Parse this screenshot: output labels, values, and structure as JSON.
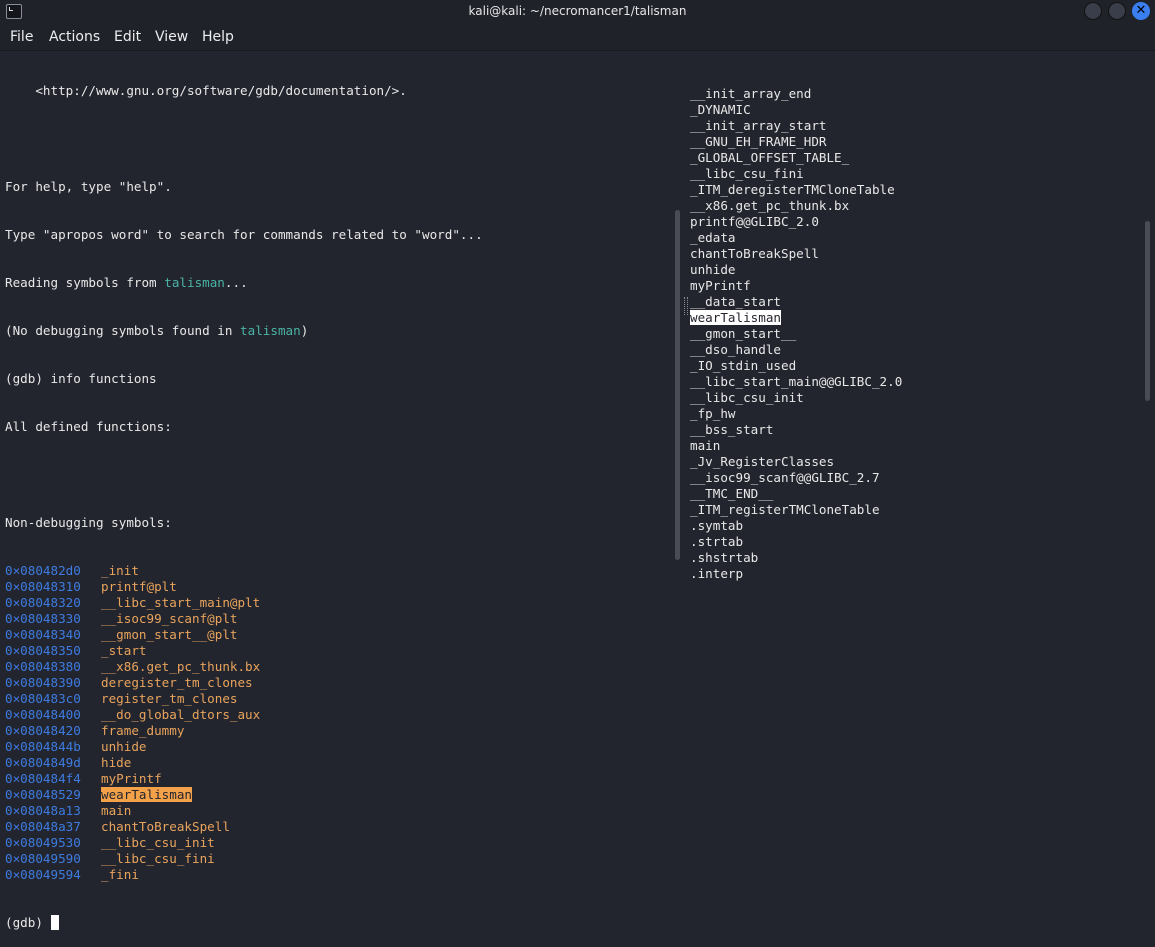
{
  "window": {
    "title": "kali@kali: ~/necromancer1/talisman",
    "icon": "terminal-icon",
    "controls": [
      "minimize",
      "maximize",
      "close"
    ]
  },
  "menu": [
    "File",
    "Actions",
    "Edit",
    "View",
    "Help"
  ],
  "left_pane": {
    "intro_lines": [
      "    <http://www.gnu.org/software/gdb/documentation/>.",
      "",
      "For help, type \"help\".",
      "Type \"apropos word\" to search for commands related to \"word\"..."
    ],
    "reading_prefix": "Reading symbols from ",
    "reading_file": "talisman",
    "reading_suffix": "...",
    "nodebug_prefix": "(No debugging symbols found in ",
    "nodebug_file": "talisman",
    "nodebug_suffix": ")",
    "command": "(gdb) info functions",
    "all_defined": "All defined functions:",
    "blank": "",
    "non_debug_header": "Non-debugging symbols:",
    "symbols": [
      {
        "addr": "0×080482d0",
        "name": "_init"
      },
      {
        "addr": "0×08048310",
        "name": "printf@plt"
      },
      {
        "addr": "0×08048320",
        "name": "__libc_start_main@plt"
      },
      {
        "addr": "0×08048330",
        "name": "__isoc99_scanf@plt"
      },
      {
        "addr": "0×08048340",
        "name": "__gmon_start__@plt"
      },
      {
        "addr": "0×08048350",
        "name": "_start"
      },
      {
        "addr": "0×08048380",
        "name": "__x86.get_pc_thunk.bx"
      },
      {
        "addr": "0×08048390",
        "name": "deregister_tm_clones"
      },
      {
        "addr": "0×080483c0",
        "name": "register_tm_clones"
      },
      {
        "addr": "0×08048400",
        "name": "__do_global_dtors_aux"
      },
      {
        "addr": "0×08048420",
        "name": "frame_dummy"
      },
      {
        "addr": "0×0804844b",
        "name": "unhide"
      },
      {
        "addr": "0×0804849d",
        "name": "hide"
      },
      {
        "addr": "0×080484f4",
        "name": "myPrintf"
      },
      {
        "addr": "0×08048529",
        "name": "wearTalisman",
        "highlight": true
      },
      {
        "addr": "0×08048a13",
        "name": "main"
      },
      {
        "addr": "0×08048a37",
        "name": "chantToBreakSpell"
      },
      {
        "addr": "0×08049530",
        "name": "__libc_csu_init"
      },
      {
        "addr": "0×08049590",
        "name": "__libc_csu_fini"
      },
      {
        "addr": "0×08049594",
        "name": "_fini"
      }
    ],
    "prompt": "(gdb) "
  },
  "right_pane": {
    "lines": [
      "__init_array_end",
      "_DYNAMIC",
      "__init_array_start",
      "__GNU_EH_FRAME_HDR",
      "_GLOBAL_OFFSET_TABLE_",
      "__libc_csu_fini",
      "_ITM_deregisterTMCloneTable",
      "__x86.get_pc_thunk.bx",
      "printf@@GLIBC_2.0",
      "_edata",
      "chantToBreakSpell",
      "unhide",
      "myPrintf",
      "__data_start",
      "wearTalisman",
      "__gmon_start__",
      "__dso_handle",
      "_IO_stdin_used",
      "__libc_start_main@@GLIBC_2.0",
      "__libc_csu_init",
      "_fp_hw",
      "__bss_start",
      "main",
      "_Jv_RegisterClasses",
      "__isoc99_scanf@@GLIBC_2.7",
      "__TMC_END__",
      "_ITM_registerTMCloneTable",
      ".symtab",
      ".strtab",
      ".shstrtab",
      ".interp"
    ],
    "highlight_index": 14
  },
  "colors": {
    "background": "#23252e",
    "address": "#3d7be0",
    "function": "#e8a35c",
    "highlight": "#f4a24a",
    "filename": "#4ab3a6",
    "close_button": "#3a7ff0"
  }
}
